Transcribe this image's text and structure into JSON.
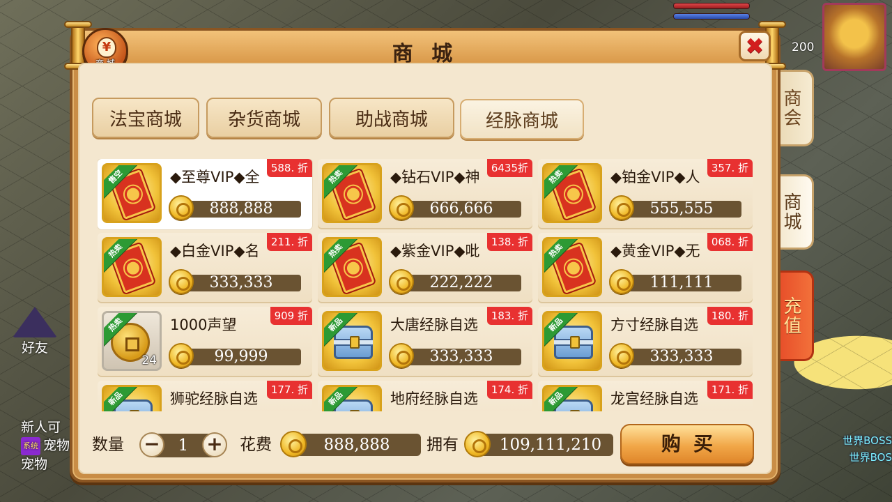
{
  "window": {
    "title": "商 城",
    "badge_label": "商 城",
    "badge_symbol": "¥",
    "close_symbol": "✖"
  },
  "background": {
    "friend_label": "好友",
    "chat_lines": [
      "新人可",
      "宠物",
      "宠物"
    ],
    "chat_tag": "系统",
    "boss_lines": [
      "世界BOSS",
      "世界BOS"
    ],
    "level_value": "200"
  },
  "side_tabs": [
    {
      "label": "商会"
    },
    {
      "label": "商城"
    },
    {
      "label": "充值"
    }
  ],
  "categories": [
    {
      "label": "法宝商城",
      "active": false
    },
    {
      "label": "杂货商城",
      "active": false
    },
    {
      "label": "助战商城",
      "active": false
    },
    {
      "label": "经脉商城",
      "active": true
    }
  ],
  "items": [
    {
      "name": "◆至尊VIP◆全",
      "price": "888,888",
      "discount": "588. 折",
      "tag": "售空",
      "icon": "red-ticket-icon",
      "selected": true
    },
    {
      "name": "◆钻石VIP◆神",
      "price": "666,666",
      "discount": "6435折",
      "tag": "热卖",
      "icon": "red-ticket-icon"
    },
    {
      "name": "◆铂金VIP◆人",
      "price": "555,555",
      "discount": "357. 折",
      "tag": "热卖",
      "icon": "red-ticket-icon"
    },
    {
      "name": "◆白金VIP◆名",
      "price": "333,333",
      "discount": "211. 折",
      "tag": "热卖",
      "icon": "red-ticket-icon"
    },
    {
      "name": "◆紫金VIP◆吡",
      "price": "222,222",
      "discount": "138. 折",
      "tag": "热卖",
      "icon": "red-ticket-icon"
    },
    {
      "name": "◆黄金VIP◆无",
      "price": "111,111",
      "discount": "068. 折",
      "tag": "热卖",
      "icon": "red-ticket-icon"
    },
    {
      "name": "1000声望",
      "price": "99,999",
      "discount": "909 折",
      "tag": "热卖",
      "icon": "gold-coin-icon",
      "count": "24"
    },
    {
      "name": "大唐经脉自选",
      "price": "333,333",
      "discount": "183. 折",
      "tag": "新品",
      "icon": "treasure-chest-icon"
    },
    {
      "name": "方寸经脉自选",
      "price": "333,333",
      "discount": "180. 折",
      "tag": "新品",
      "icon": "treasure-chest-icon"
    },
    {
      "name": "狮驼经脉自选",
      "price": "",
      "discount": "177. 折",
      "tag": "新品",
      "icon": "treasure-chest-icon"
    },
    {
      "name": "地府经脉自选",
      "price": "",
      "discount": "174. 折",
      "tag": "新品",
      "icon": "treasure-chest-icon"
    },
    {
      "name": "龙宫经脉自选",
      "price": "",
      "discount": "171. 折",
      "tag": "新品",
      "icon": "treasure-chest-icon"
    }
  ],
  "footer": {
    "qty_label": "数量",
    "qty_value": "1",
    "minus_symbol": "−",
    "plus_symbol": "+",
    "cost_label": "花费",
    "cost_value": "888,888",
    "own_label": "拥有",
    "own_value": "109,111,210",
    "buy_label": "购买"
  },
  "colors": {
    "panel_frame": "#c98d46",
    "panel_bg": "#f4e7cf",
    "discount_badge": "#e83131",
    "tag_green": "#2d9a34",
    "value_bar": "#6a5332",
    "recharge_tab": "#e44625"
  }
}
